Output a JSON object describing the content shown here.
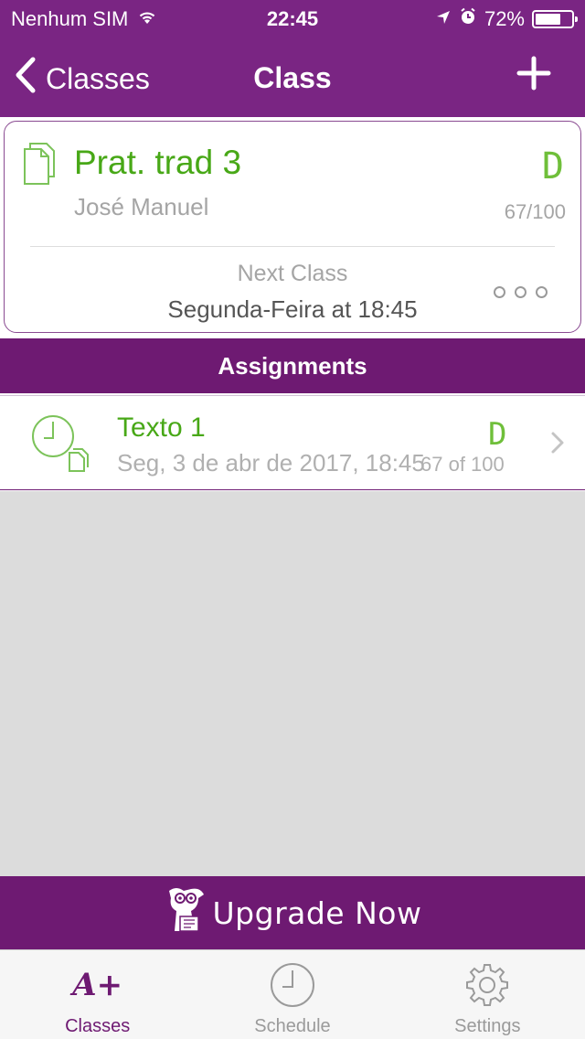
{
  "status_bar": {
    "carrier": "Nenhum SIM",
    "time": "22:45",
    "battery": "72%",
    "battery_level": 0.72
  },
  "nav": {
    "back_label": "Classes",
    "title": "Class"
  },
  "class_card": {
    "name": "Prat. trad 3",
    "teacher": "José Manuel",
    "grade": "D",
    "score": "67/100",
    "next_label": "Next Class",
    "next_time": "Segunda-Feira at 18:45"
  },
  "section": {
    "title": "Assignments"
  },
  "assignments": [
    {
      "title": "Texto 1",
      "date": "Seg, 3 de abr de 2017, 18:45",
      "grade": "D",
      "score": "67 of 100"
    }
  ],
  "upgrade": {
    "label": "Upgrade Now"
  },
  "tabs": [
    {
      "label": "Classes",
      "icon_text": "A+",
      "active": true
    },
    {
      "label": "Schedule",
      "active": false
    },
    {
      "label": "Settings",
      "active": false
    }
  ],
  "colors": {
    "brand_purple": "#7a2583",
    "dark_purple": "#6e1a72",
    "grade_green": "#48a817"
  }
}
